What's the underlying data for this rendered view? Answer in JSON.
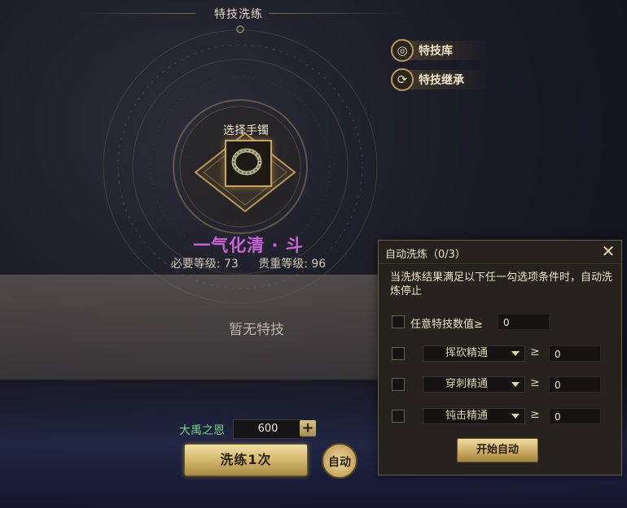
{
  "title": "特技洗练",
  "side_buttons": [
    {
      "label": "特技库",
      "icon": "swirl-icon"
    },
    {
      "label": "特技继承",
      "icon": "cycle-icon"
    }
  ],
  "slot": {
    "label": "选择手镯"
  },
  "item": {
    "name": "一气化清 · 斗",
    "required_level": "必要等级: 73",
    "value_level": "贵重等级: 96"
  },
  "panel": {
    "empty_text": "暂无特技"
  },
  "currency": {
    "label": "大禹之恩",
    "value": "600",
    "plus": "+"
  },
  "buttons": {
    "refine": "洗练1次",
    "auto": "自动"
  },
  "dialog": {
    "title": "自动洗炼（0/3）",
    "close": "✕",
    "description": "当洗炼结果满足以下任一勾选项条件时，自动洗炼停止",
    "any_row": {
      "label": "任意特技数值≥",
      "value": "0"
    },
    "rows": [
      {
        "select": "挥砍精通",
        "ge": "≥",
        "value": "0"
      },
      {
        "select": "穿刺精通",
        "ge": "≥",
        "value": "0"
      },
      {
        "select": "钝击精通",
        "ge": "≥",
        "value": "0"
      }
    ],
    "start": "开始自动"
  },
  "colors": {
    "item_name": "#c964d8",
    "currency_label": "#74d38a",
    "gold": "#c9a45a"
  }
}
